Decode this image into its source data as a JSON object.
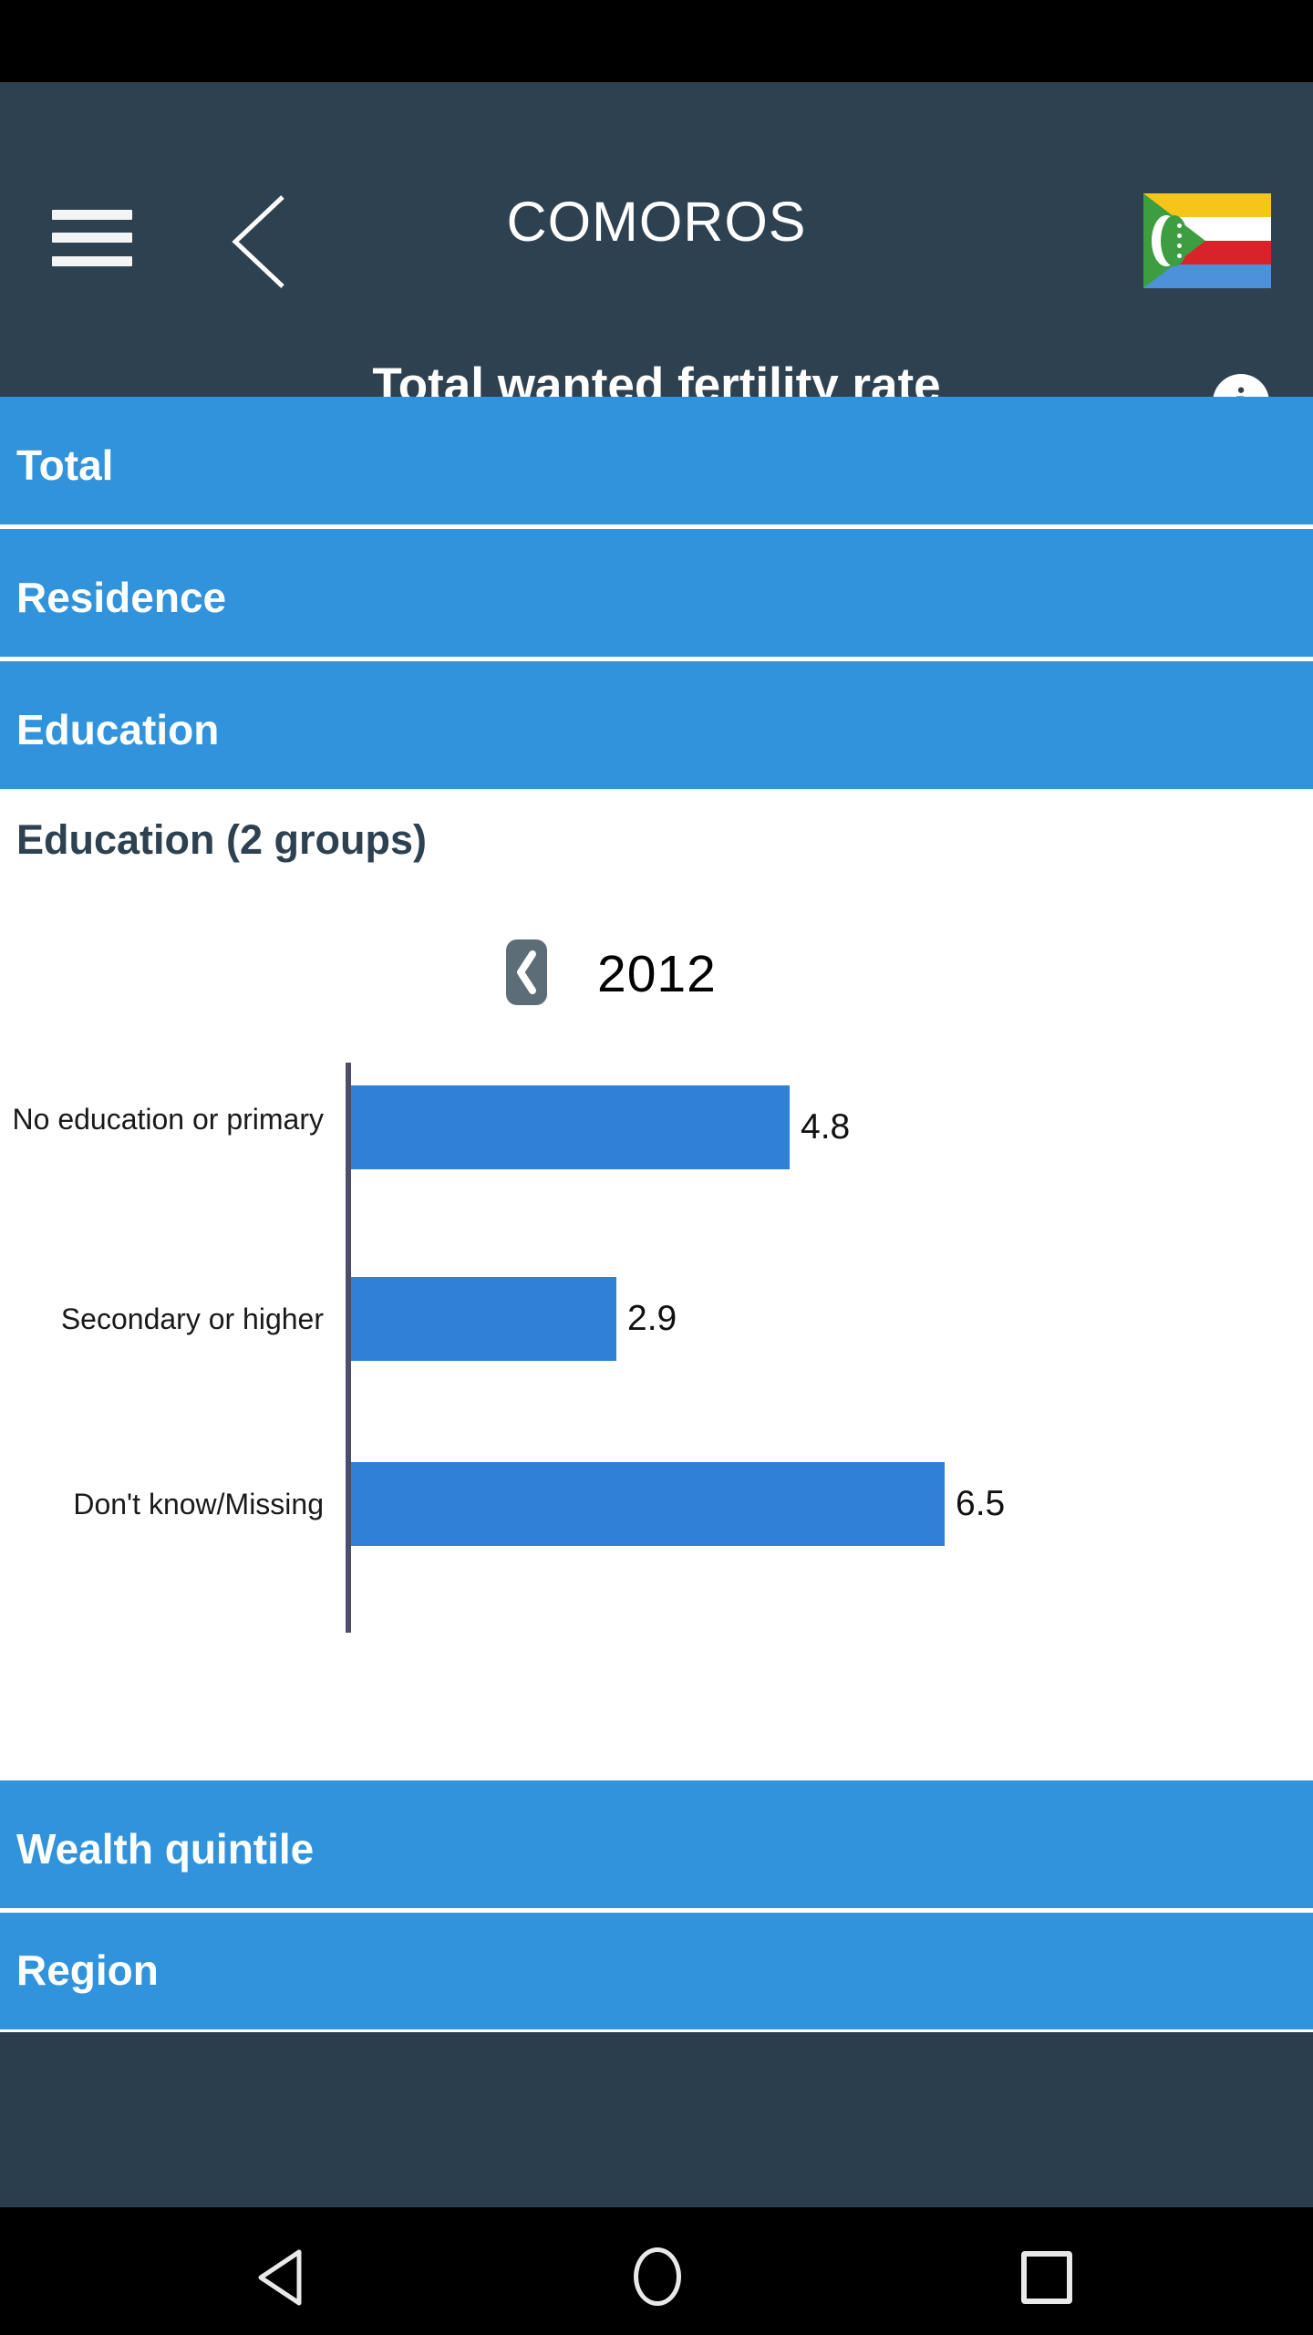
{
  "app_bar": {
    "menu_icon": "hamburger-menu-icon",
    "back_icon": "chevron-left-icon",
    "country": "COMOROS",
    "flag_icon": "comoros-flag-icon",
    "indicator": "Total wanted fertility rate",
    "info_icon": "info-icon",
    "info_glyph": "i"
  },
  "categories": [
    {
      "label": "Total",
      "expanded": false
    },
    {
      "label": "Residence",
      "expanded": false
    },
    {
      "label": "Education",
      "expanded": true
    }
  ],
  "expanded_section": {
    "heading": "Education (2 groups)",
    "year_prev_icon": "chevron-left-icon",
    "year": "2012"
  },
  "categories_bottom": [
    {
      "label": "Wealth quintile",
      "expanded": false
    },
    {
      "label": "Region",
      "expanded": false
    }
  ],
  "chart_data": {
    "type": "bar",
    "orientation": "horizontal",
    "title": "Total wanted fertility rate",
    "subtitle": "Education (2 groups)",
    "year": "2012",
    "categories": [
      "No education or primary",
      "Secondary or higher",
      "Don't know/Missing"
    ],
    "values": [
      4.8,
      2.9,
      6.5
    ],
    "value_labels": [
      "4.8",
      "2.9",
      "6.5"
    ],
    "xlabel": "",
    "ylabel": "",
    "xlim": [
      0,
      7.2
    ],
    "grid": false,
    "legend": false,
    "bar_color": "#3080d8",
    "axis_color": "#4e4c6a"
  },
  "nav_bar": {
    "back_icon": "triangle-back-icon",
    "home_icon": "circle-home-icon",
    "recents_icon": "square-recents-icon"
  },
  "colors": {
    "app_bar": "#2e4150",
    "category_row": "#3193db",
    "bar": "#3080d8",
    "page": "#ffffff",
    "nav_bar": "#000000"
  }
}
